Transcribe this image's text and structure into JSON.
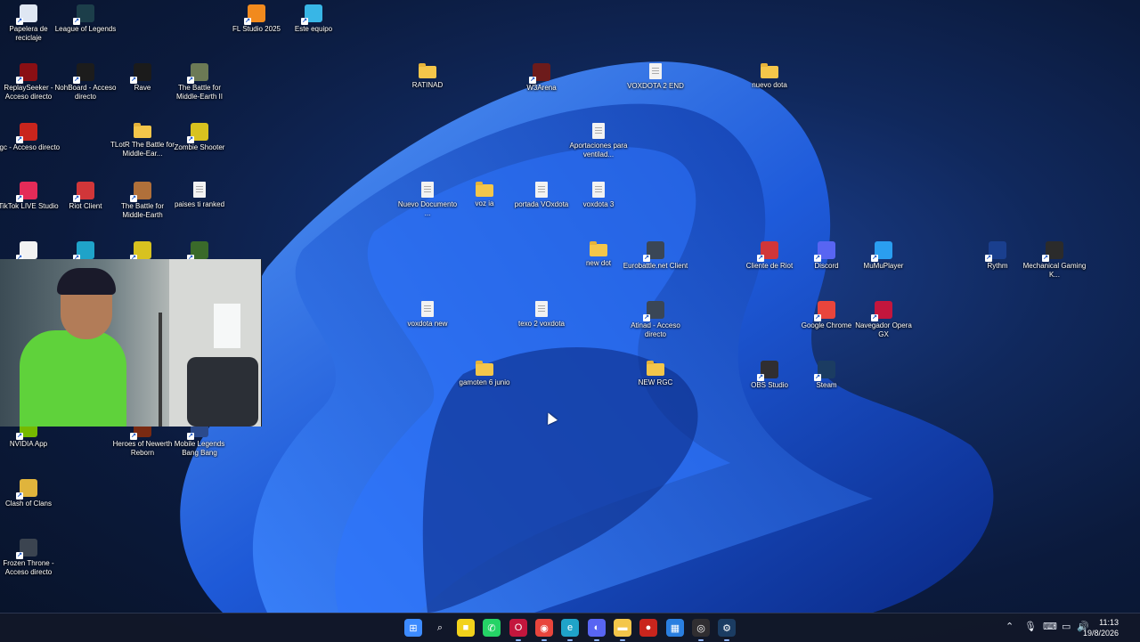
{
  "desktop": {
    "icons": [
      {
        "label": "Papelera de reciclaje",
        "icon": "recycle-bin-icon",
        "color": "#dfe7f3"
      },
      {
        "label": "League of Legends",
        "icon": "league-of-legends-icon",
        "color": "#1c3e4a"
      },
      {
        "label": "FL Studio 2025",
        "icon": "fl-studio-icon",
        "color": "#f18a1e"
      },
      {
        "label": "Este equipo",
        "icon": "computer-icon",
        "color": "#38b6e6"
      },
      {
        "label": "ReplaySeeker - Acceso directo",
        "icon": "replayseeker-icon",
        "color": "#8a0f14"
      },
      {
        "label": "NohBoard - Acceso directo",
        "icon": "nohboard-icon",
        "color": "#1c1c1c"
      },
      {
        "label": "Rave",
        "icon": "rave-icon",
        "color": "#1b1b1b"
      },
      {
        "label": "The Battle for Middle-Earth II",
        "icon": "bfme2-icon",
        "color": "#6c7a55"
      },
      {
        "label": "RATINAD",
        "icon": "folder-icon",
        "color": "#f4c64a"
      },
      {
        "label": "W3Arena",
        "icon": "w3arena-icon",
        "color": "#6d1b1b"
      },
      {
        "label": "VOXDOTA 2 END",
        "icon": "document-icon",
        "color": "#f2f2f2"
      },
      {
        "label": "nuevo dota",
        "icon": "folder-icon",
        "color": "#f4c64a"
      },
      {
        "label": "rgc - Acceso directo",
        "icon": "rgc-icon",
        "color": "#c9251d"
      },
      {
        "label": "TLotR The Battle for Middle-Ear...",
        "icon": "folder-icon",
        "color": "#f4c64a"
      },
      {
        "label": "Zombie Shooter",
        "icon": "zombie-shooter-icon",
        "color": "#d8c21f"
      },
      {
        "label": "Aportaciones para ventilad...",
        "icon": "document-icon",
        "color": "#f2f2f2"
      },
      {
        "label": "TikTok LIVE Studio",
        "icon": "tiktok-live-icon",
        "color": "#e42b58"
      },
      {
        "label": "Riot Client",
        "icon": "riot-client-icon",
        "color": "#d13639"
      },
      {
        "label": "The Battle for Middle-Earth",
        "icon": "bfme-icon",
        "color": "#b0703a"
      },
      {
        "label": "paises ti ranked",
        "icon": "document-icon",
        "color": "#f2f2f2"
      },
      {
        "label": "Nuevo Documento ...",
        "icon": "document-icon",
        "color": "#f2f2f2"
      },
      {
        "label": "voz ia",
        "icon": "folder-icon",
        "color": "#f4c64a"
      },
      {
        "label": "portada VOxdota",
        "icon": "document-icon",
        "color": "#f2f2f2"
      },
      {
        "label": "voxdota 3",
        "icon": "document-icon",
        "color": "#f2f2f2"
      },
      {
        "label": "new dot",
        "icon": "folder-icon",
        "color": "#f4c64a"
      },
      {
        "label": "Eurobattle.net Client",
        "icon": "eurobattle-icon",
        "color": "#3a4656"
      },
      {
        "label": "Cliente de Riot",
        "icon": "riot-client-icon",
        "color": "#d13639"
      },
      {
        "label": "Discord",
        "icon": "discord-icon",
        "color": "#5865f2"
      },
      {
        "label": "MuMuPlayer",
        "icon": "mumuplayer-icon",
        "color": "#2a9ef0"
      },
      {
        "label": "Rythm",
        "icon": "rythm-icon",
        "color": "#1a3f8e"
      },
      {
        "label": "Mechanical Gaming K...",
        "icon": "keyboard-icon",
        "color": "#2b2b2b"
      },
      {
        "label": "voxdota new",
        "icon": "document-icon",
        "color": "#f2f2f2"
      },
      {
        "label": "texo 2 voxdota",
        "icon": "document-icon",
        "color": "#f2f2f2"
      },
      {
        "label": "Atinad - Acceso directo",
        "icon": "atinad-icon",
        "color": "#3a4656"
      },
      {
        "label": "Google Chrome",
        "icon": "chrome-icon",
        "color": "#e8453c"
      },
      {
        "label": "Navegador Opera GX",
        "icon": "opera-gx-icon",
        "color": "#c3163d"
      },
      {
        "label": "gamoten 6 junio",
        "icon": "folder-icon",
        "color": "#f4c64a"
      },
      {
        "label": "NEW RGC",
        "icon": "folder-icon",
        "color": "#f4c64a"
      },
      {
        "label": "OBS Studio",
        "icon": "obs-icon",
        "color": "#302e31"
      },
      {
        "label": "Steam",
        "icon": "steam-icon",
        "color": "#1b3c62"
      },
      {
        "label": "NVIDIA App",
        "icon": "nvidia-icon",
        "color": "#76b900"
      },
      {
        "label": "Heroes of Newerth Reborn",
        "icon": "hon-icon",
        "color": "#7a2a12"
      },
      {
        "label": "Mobile Legends Bang Bang",
        "icon": "mobile-legends-icon",
        "color": "#2b4a8c"
      },
      {
        "label": "Clash of Clans",
        "icon": "clash-of-clans-icon",
        "color": "#e0b43c"
      },
      {
        "label": "Frozen Throne - Acceso directo",
        "icon": "frozen-throne-icon",
        "color": "#3b4450"
      },
      {
        "label": "",
        "icon": "app-icon",
        "color": "#f2f2f2"
      },
      {
        "label": "",
        "icon": "edge-icon",
        "color": "#1fa3c9"
      },
      {
        "label": "",
        "icon": "app-icon",
        "color": "#d8c21f"
      },
      {
        "label": "",
        "icon": "app-icon",
        "color": "#3a6a2a"
      }
    ]
  },
  "taskbar": {
    "apps": [
      {
        "icon": "windows-start-icon",
        "color": "#3d8bff",
        "glyph": "⊞"
      },
      {
        "icon": "search-icon",
        "color": "transparent",
        "glyph": "⌕"
      },
      {
        "icon": "sticky-notes-icon",
        "color": "#f2d21b",
        "glyph": "■"
      },
      {
        "icon": "whatsapp-icon",
        "color": "#25d366",
        "glyph": "✆"
      },
      {
        "icon": "opera-gx-icon",
        "color": "#c3163d",
        "glyph": "O"
      },
      {
        "icon": "chrome-icon",
        "color": "#e8453c",
        "glyph": "◉"
      },
      {
        "icon": "edge-icon",
        "color": "#1fa3c9",
        "glyph": "e"
      },
      {
        "icon": "discord-icon",
        "color": "#5865f2",
        "glyph": "◐"
      },
      {
        "icon": "file-explorer-icon",
        "color": "#f4c64a",
        "glyph": "▬"
      },
      {
        "icon": "app-red-icon",
        "color": "#c9251d",
        "glyph": "●"
      },
      {
        "icon": "store-icon",
        "color": "#2a7fe0",
        "glyph": "▦"
      },
      {
        "icon": "obs-icon",
        "color": "#302e31",
        "glyph": "◎"
      },
      {
        "icon": "steam-icon",
        "color": "#1b3c62",
        "glyph": "⚙"
      }
    ],
    "tray": [
      {
        "icon": "chevron-up-icon",
        "glyph": "⌃"
      },
      {
        "icon": "microphone-icon",
        "glyph": "🎙"
      },
      {
        "icon": "keyboard-icon",
        "glyph": "⌨"
      },
      {
        "icon": "network-icon",
        "glyph": "▭"
      },
      {
        "icon": "volume-icon",
        "glyph": "🔊"
      }
    ],
    "time": "11:13",
    "date": "19/8/2026"
  }
}
